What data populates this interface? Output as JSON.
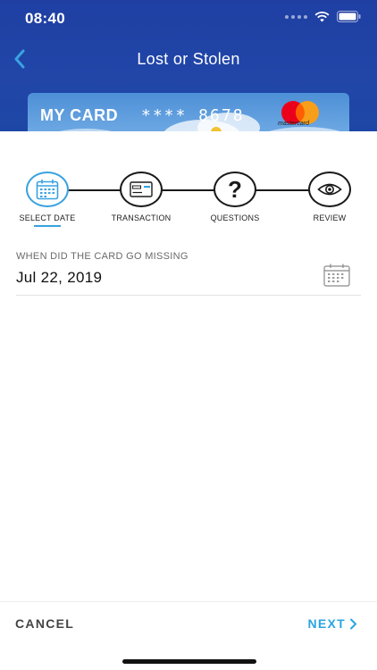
{
  "status_bar": {
    "time": "08:40"
  },
  "nav": {
    "title": "Lost or Stolen",
    "back_icon": "chevron-left-icon"
  },
  "card": {
    "name": "MY CARD",
    "number": "**** 8678",
    "network": "mastercard"
  },
  "stepper": {
    "steps": [
      {
        "label": "SELECT DATE",
        "icon": "calendar-icon",
        "active": true
      },
      {
        "label": "TRANSACTION",
        "icon": "credit-card-icon",
        "active": false
      },
      {
        "label": "QUESTIONS",
        "icon": "question-icon",
        "active": false
      },
      {
        "label": "REVIEW",
        "icon": "eye-icon",
        "active": false
      }
    ]
  },
  "date_field": {
    "label": "WHEN DID THE CARD GO MISSING",
    "value": "Jul 22, 2019",
    "icon": "calendar-icon"
  },
  "footer": {
    "cancel_label": "CANCEL",
    "next_label": "NEXT"
  },
  "colors": {
    "header_blue": "#2146a8",
    "accent_blue": "#3aa2e0",
    "next_blue": "#2aa5e0"
  }
}
